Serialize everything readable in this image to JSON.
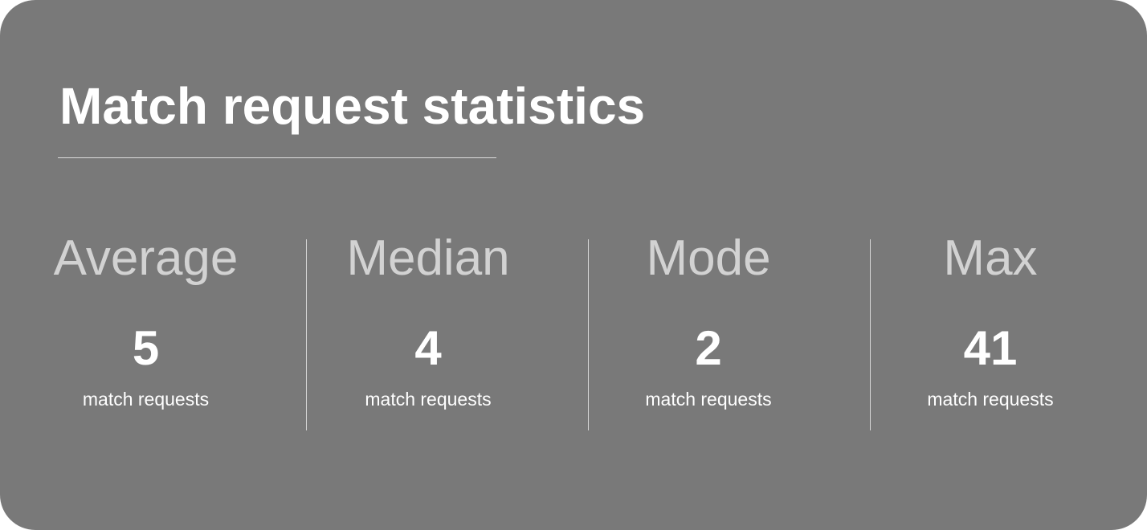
{
  "card": {
    "title": "Match request statistics",
    "background_color": "#797979",
    "title_color": "#ffffff",
    "label_color": "#d2d2d2",
    "divider_color": "#d6d6d6"
  },
  "stats": [
    {
      "label": "Average",
      "value": "5",
      "unit": "match requests"
    },
    {
      "label": "Median",
      "value": "4",
      "unit": "match requests"
    },
    {
      "label": "Mode",
      "value": "2",
      "unit": "match requests"
    },
    {
      "label": "Max",
      "value": "41",
      "unit": "match requests"
    }
  ]
}
